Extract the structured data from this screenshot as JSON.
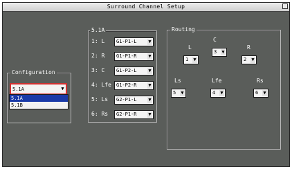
{
  "window": {
    "title": "Surround Channel Setup"
  },
  "configuration": {
    "title": "Configuration",
    "value": "5.1A",
    "options": [
      {
        "label": "5.1A",
        "selected": true
      },
      {
        "label": "5.1B",
        "selected": false
      }
    ]
  },
  "channels": {
    "title": "5.1A",
    "rows": [
      {
        "label": "1: L",
        "value": "G1-P1-L"
      },
      {
        "label": "2: R",
        "value": "G1-P1-R"
      },
      {
        "label": "3: C",
        "value": "G1-P2-L"
      },
      {
        "label": "4: Lfe",
        "value": "G1-P2-R"
      },
      {
        "label": "5: Ls",
        "value": "G2-P1-L"
      },
      {
        "label": "6: Rs",
        "value": "G2-P1-R"
      }
    ]
  },
  "routing": {
    "title": "Routing",
    "items": [
      {
        "label": "L",
        "value": "1"
      },
      {
        "label": "C",
        "value": "3"
      },
      {
        "label": "R",
        "value": "2"
      },
      {
        "label": "Ls",
        "value": "5"
      },
      {
        "label": "Lfe",
        "value": "4"
      },
      {
        "label": "Rs",
        "value": "6"
      }
    ]
  },
  "icons": {
    "dropdown_arrow": "▼"
  },
  "colors": {
    "background": "#5a5d5a",
    "focus_border": "#d03030",
    "selection": "#1a3aa8"
  }
}
